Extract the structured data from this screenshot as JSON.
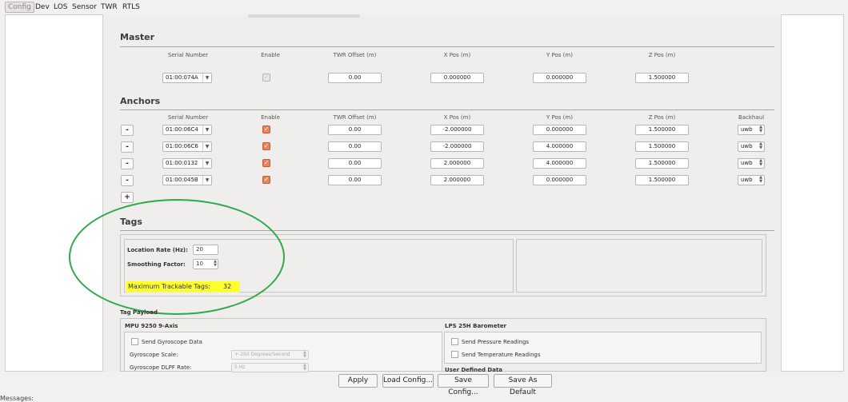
{
  "tabs": [
    "Config",
    "Dev",
    "LOS",
    "Sensor",
    "TWR",
    "RTLS"
  ],
  "master": {
    "title": "Master",
    "headers": [
      "Serial Number",
      "Enable",
      "TWR Offset (m)",
      "X Pos (m)",
      "Y Pos (m)",
      "Z Pos (m)"
    ],
    "serial": "01:00:074A",
    "enabled": true,
    "twr_offset": "0.00",
    "x": "0.000000",
    "y": "0.000000",
    "z": "1.500000"
  },
  "anchors": {
    "title": "Anchors",
    "headers": [
      "Serial Number",
      "Enable",
      "TWR Offset (m)",
      "X Pos (m)",
      "Y Pos (m)",
      "Z Pos (m)",
      "Backhaul"
    ],
    "remove_label": "-",
    "add_label": "+",
    "rows": [
      {
        "serial": "01:00:06C4",
        "enabled": true,
        "twr_offset": "0.00",
        "x": "-2.000000",
        "y": "0.000000",
        "z": "1.500000",
        "backhaul": "uwb"
      },
      {
        "serial": "01:00:06C6",
        "enabled": true,
        "twr_offset": "0.00",
        "x": "-2.000000",
        "y": "4.000000",
        "z": "1.500000",
        "backhaul": "uwb"
      },
      {
        "serial": "01:00:0132",
        "enabled": true,
        "twr_offset": "0.00",
        "x": "2.000000",
        "y": "4.000000",
        "z": "1.500000",
        "backhaul": "uwb"
      },
      {
        "serial": "01:00:045B",
        "enabled": true,
        "twr_offset": "0.00",
        "x": "2.000000",
        "y": "0.000000",
        "z": "1.500000",
        "backhaul": "uwb"
      }
    ]
  },
  "tags": {
    "title": "Tags",
    "location_rate_label": "Location Rate (Hz):",
    "location_rate": "20",
    "smoothing_label": "Smoothing Factor:",
    "smoothing": "10",
    "max_tags_label": "Maximum Trackable Tags:",
    "max_tags": "32"
  },
  "payload": {
    "title": "Tag Payload",
    "mpu_title": "MPU 9250 9-Axis",
    "send_gyro": "Send Gyroscope Data",
    "gyro_scale_label": "Gyroscope Scale:",
    "gyro_scale": "+-250 Degrees/Second",
    "gyro_dlpf_label": "Gyroscope DLPF Rate:",
    "gyro_dlpf": "5 Hz",
    "lps_title": "LPS 25H Barometer",
    "send_pressure": "Send Pressure Readings",
    "send_temperature": "Send Temperature Readings",
    "user_defined": "User Defined Data"
  },
  "buttons": {
    "apply": "Apply",
    "load": "Load Config...",
    "save": "Save Config...",
    "save_default": "Save As Default"
  },
  "messages_label": "Messages:",
  "colors": {
    "highlight": "#ffff2e",
    "annotation": "#2da84a",
    "checkbox_on": "#e8845a"
  }
}
